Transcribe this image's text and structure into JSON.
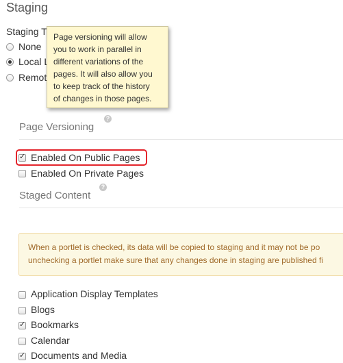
{
  "staging": {
    "title": "Staging",
    "type_label": "Staging T",
    "options": [
      {
        "label": "None",
        "checked": false
      },
      {
        "label": "Local L",
        "checked": true
      },
      {
        "label": "Remot",
        "checked": false
      }
    ]
  },
  "tooltip": {
    "text": "Page versioning will allow\nyou to work in parallel in\ndifferent variations of the\npages. It will also allow you\nto keep track of the history\nof changes in those pages."
  },
  "page_versioning": {
    "title": "Page Versioning",
    "help_icon": "question-icon",
    "items": [
      {
        "label": "Enabled On Public Pages",
        "checked": true
      },
      {
        "label": "Enabled On Private Pages",
        "checked": false
      }
    ]
  },
  "staged_content": {
    "title": "Staged Content",
    "help_icon": "question-icon",
    "alert_line1": "When a portlet is checked, its data will be copied to staging and it may not be po",
    "alert_line2": "unchecking a portlet make sure that any changes done in staging are published fi",
    "portlets": [
      {
        "label": "Application Display Templates",
        "checked": false
      },
      {
        "label": "Blogs",
        "checked": false
      },
      {
        "label": "Bookmarks",
        "checked": true
      },
      {
        "label": "Calendar",
        "checked": false
      },
      {
        "label": "Documents and Media",
        "checked": true
      }
    ]
  },
  "colors": {
    "highlight": "#e3242b",
    "tooltip_bg": "#fff8d0",
    "alert_bg": "#fcf8e3",
    "alert_text": "#a06a2a"
  }
}
